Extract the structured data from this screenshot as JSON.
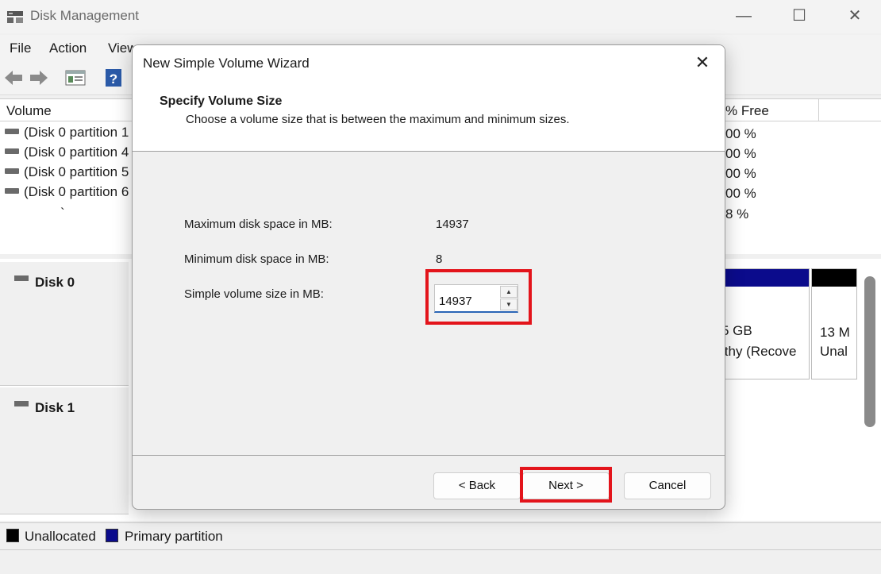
{
  "window": {
    "title": "Disk Management",
    "controls": {
      "minimize": "—",
      "maximize": "☐",
      "close": "✕"
    },
    "menu": [
      "File",
      "Action",
      "View"
    ]
  },
  "volume_list": {
    "columns": [
      "Volume",
      "% Free"
    ],
    "rows": [
      {
        "name": "(Disk 0 partition 1",
        "free": "00 %"
      },
      {
        "name": "(Disk 0 partition 4",
        "free": "00 %"
      },
      {
        "name": "(Disk 0 partition 5",
        "free": "00 %"
      },
      {
        "name": "(Disk 0 partition 6",
        "free": "00 %"
      },
      {
        "name": "`",
        "free": "8 %"
      }
    ]
  },
  "disks": [
    {
      "label": "Disk 0",
      "partitions": [
        {
          "size": "5 GB",
          "status": "lthy (Recove"
        },
        {
          "size": "13 M",
          "status": "Unal"
        }
      ]
    },
    {
      "label": "Disk 1"
    }
  ],
  "legend": {
    "items": [
      {
        "label": "Unallocated",
        "color": "#000000"
      },
      {
        "label": "Primary partition",
        "color": "#0b0b8c"
      }
    ]
  },
  "dialog": {
    "title": "New Simple Volume Wizard",
    "close_label": "✕",
    "heading": "Specify Volume Size",
    "subheading": "Choose a volume size that is between the maximum and minimum sizes.",
    "fields": [
      {
        "label": "Maximum disk space in MB:",
        "value": "14937"
      },
      {
        "label": "Minimum disk space in MB:",
        "value": "8"
      },
      {
        "label": "Simple volume size in MB:",
        "value": "14937"
      }
    ],
    "spin_up": "▲",
    "spin_down": "▼",
    "buttons": {
      "back": "< Back",
      "next": "Next >",
      "cancel": "Cancel"
    },
    "highlight_color": "#e3141b"
  }
}
